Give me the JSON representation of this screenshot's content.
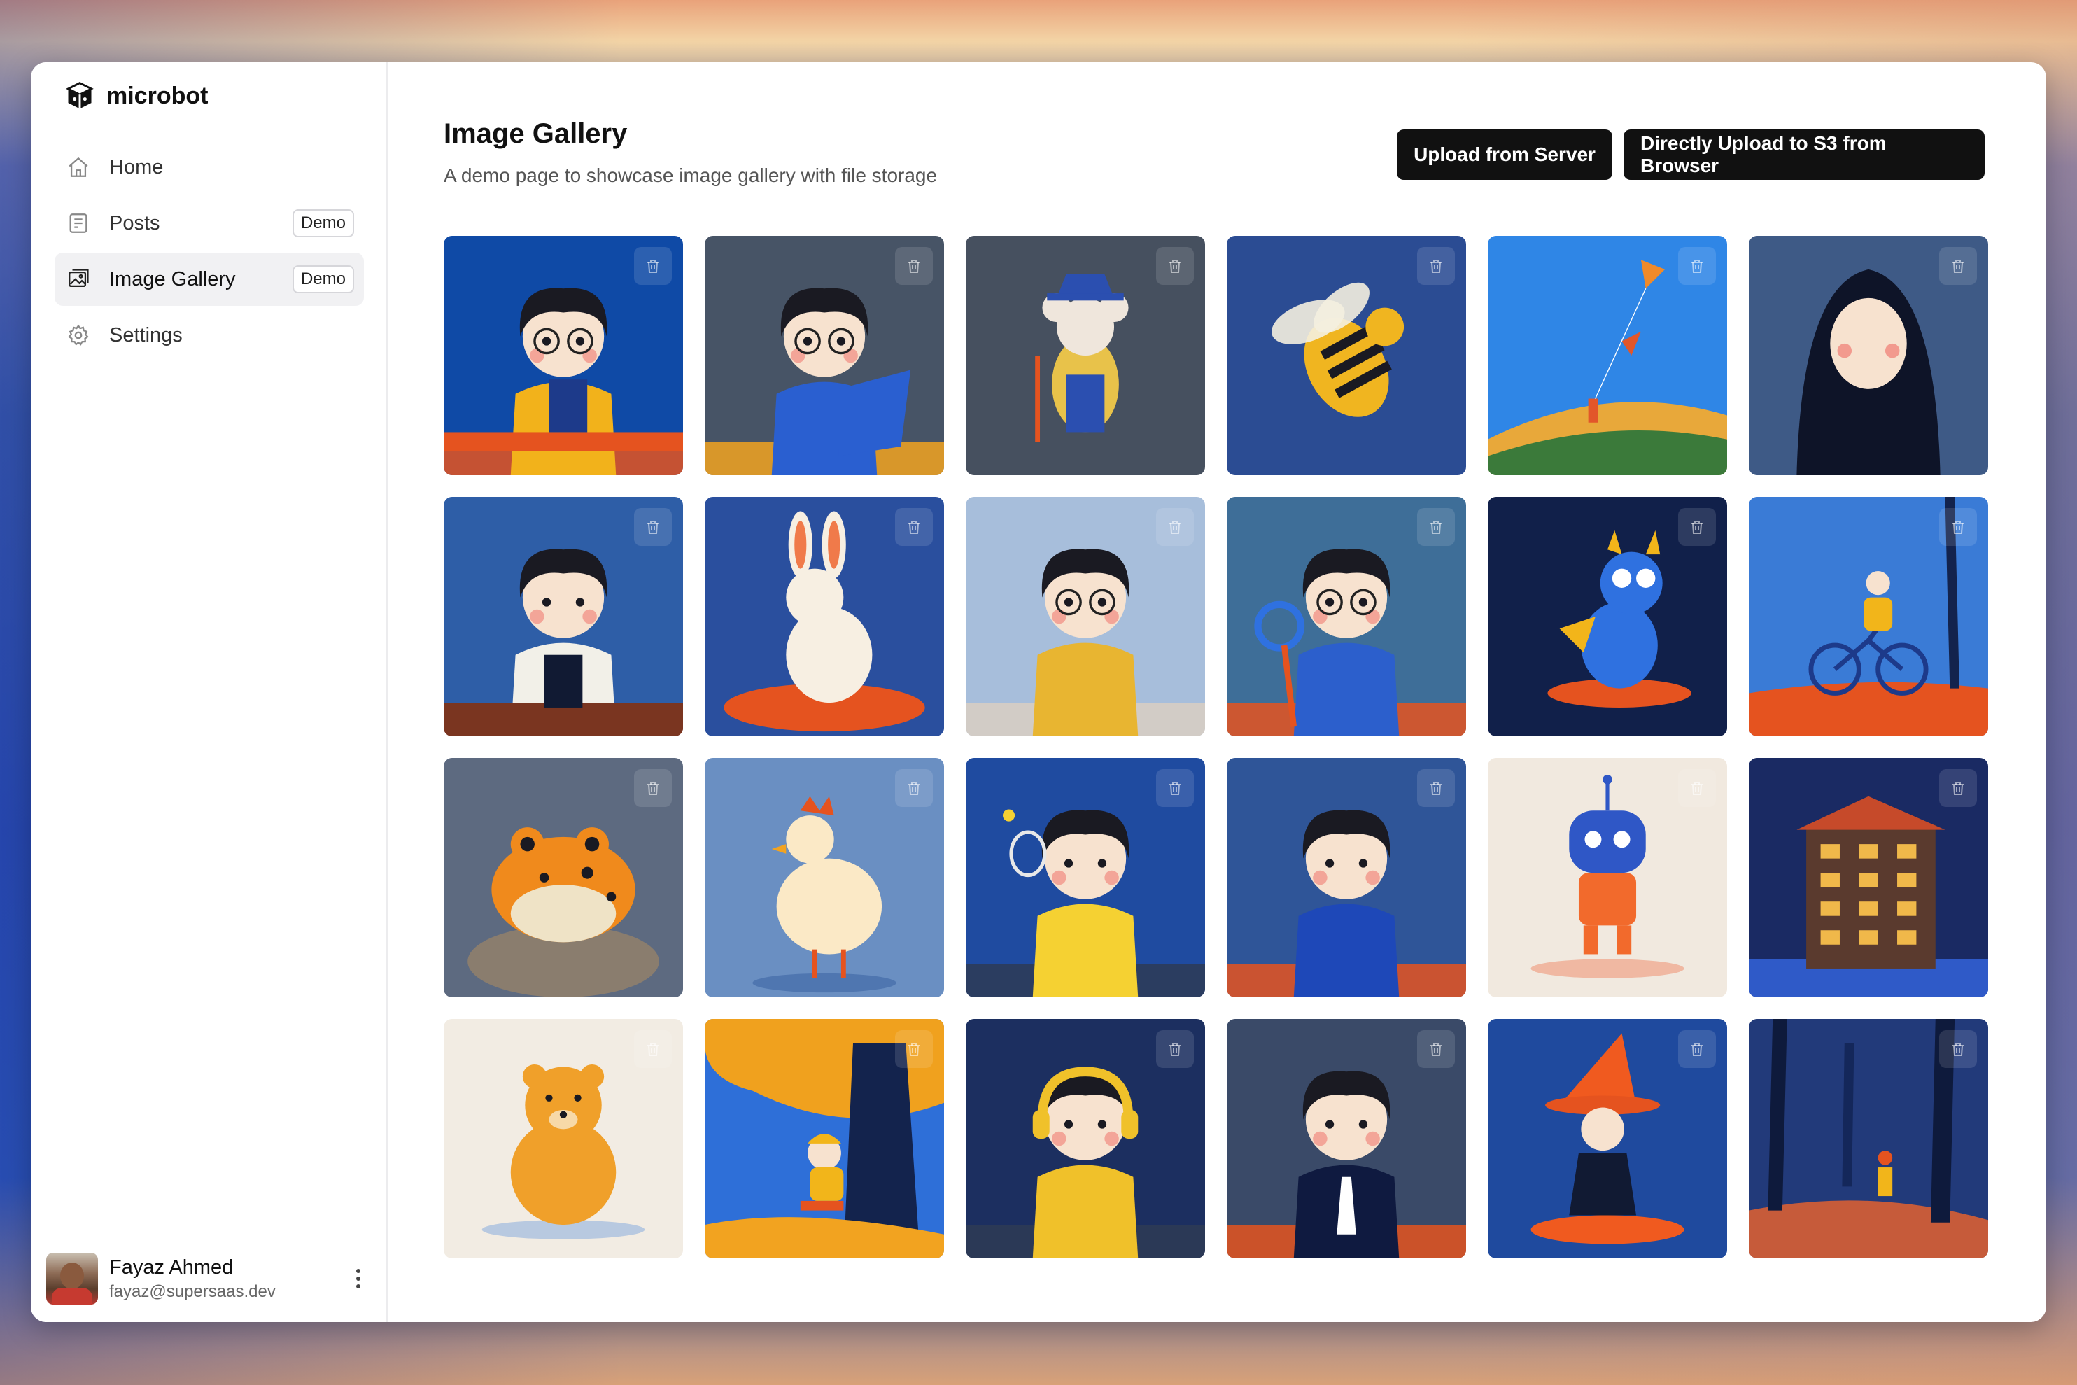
{
  "app": {
    "name": "microbot"
  },
  "sidebar": {
    "items": [
      {
        "label": "Home",
        "icon": "home-icon",
        "badge": null,
        "active": false
      },
      {
        "label": "Posts",
        "icon": "document-icon",
        "badge": "Demo",
        "active": false
      },
      {
        "label": "Image Gallery",
        "icon": "image-icon",
        "badge": "Demo",
        "active": true
      },
      {
        "label": "Settings",
        "icon": "gear-icon",
        "badge": null,
        "active": false
      }
    ]
  },
  "user": {
    "name": "Fayaz Ahmed",
    "email": "fayaz@supersaas.dev"
  },
  "main": {
    "title": "Image Gallery",
    "subtitle": "A demo page to showcase image gallery with file storage",
    "buttons": {
      "upload_server": "Upload from Server",
      "upload_s3": "Directly Upload to S3 from Browser"
    }
  },
  "gallery": [
    {
      "subject": "girl-with-glasses-desk",
      "bg": "#0f4aa6",
      "accent": "#f2b21b"
    },
    {
      "subject": "boy-with-laptop",
      "bg": "#475466",
      "accent": "#2a5fd0"
    },
    {
      "subject": "mouse-wizard",
      "bg": "#46505f",
      "accent": "#e8c24a"
    },
    {
      "subject": "bee",
      "bg": "#2b4c93",
      "accent": "#f0b520"
    },
    {
      "subject": "kite-hill",
      "bg": "#2f86e6",
      "accent": "#f08a2a"
    },
    {
      "subject": "hijab-girl",
      "bg": "#3e5a86",
      "accent": "#0e1428"
    },
    {
      "subject": "girl-apron",
      "bg": "#2e5ea7",
      "accent": "#f2f0e8"
    },
    {
      "subject": "rabbit",
      "bg": "#2a4f9e",
      "accent": "#f7efe2"
    },
    {
      "subject": "boy-scarf-glasses",
      "bg": "#a7bedb",
      "accent": "#e8b531"
    },
    {
      "subject": "boy-magnifier",
      "bg": "#3e6e98",
      "accent": "#2c5fcc"
    },
    {
      "subject": "blue-dragon",
      "bg": "#11204a",
      "accent": "#2f71e0"
    },
    {
      "subject": "girl-bicycle",
      "bg": "#3a7bd6",
      "accent": "#f26a2c"
    },
    {
      "subject": "frog",
      "bg": "#5d6a80",
      "accent": "#f08a1c"
    },
    {
      "subject": "chicken",
      "bg": "#6a8fc2",
      "accent": "#fbe9c6"
    },
    {
      "subject": "girl-tennis",
      "bg": "#1f4ba0",
      "accent": "#f5d132"
    },
    {
      "subject": "girl-peace-sign",
      "bg": "#2f5598",
      "accent": "#1e48b8"
    },
    {
      "subject": "robot",
      "bg": "#f1e9df",
      "accent": "#2f57c6"
    },
    {
      "subject": "night-building",
      "bg": "#1a2a63",
      "accent": "#f0b84a"
    },
    {
      "subject": "bear",
      "bg": "#f2ece3",
      "accent": "#f0a02a"
    },
    {
      "subject": "boy-under-tree",
      "bg": "#2e6fd8",
      "accent": "#f0a11e"
    },
    {
      "subject": "boy-headphones",
      "bg": "#1c2f60",
      "accent": "#f0c12a"
    },
    {
      "subject": "girl-blazer",
      "bg": "#3a4a68",
      "accent": "#0f1a40"
    },
    {
      "subject": "witch-girl",
      "bg": "#1f4a9e",
      "accent": "#f05a1f"
    },
    {
      "subject": "forest-walk",
      "bg": "#223a7a",
      "accent": "#f0642a"
    }
  ]
}
